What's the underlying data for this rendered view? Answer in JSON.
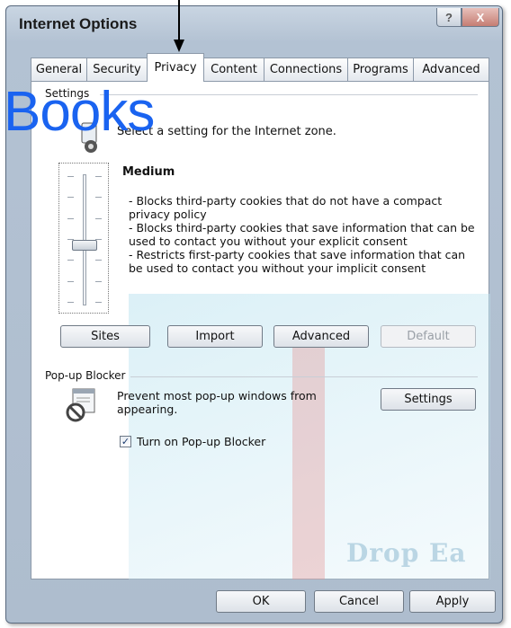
{
  "window": {
    "title": "Internet Options",
    "help_glyph": "?",
    "close_glyph": "X"
  },
  "tabs": [
    {
      "label": "General"
    },
    {
      "label": "Security"
    },
    {
      "label": "Privacy"
    },
    {
      "label": "Content"
    },
    {
      "label": "Connections"
    },
    {
      "label": "Programs"
    },
    {
      "label": "Advanced"
    }
  ],
  "active_tab": "Privacy",
  "settings": {
    "group_label": "Settings",
    "zone_text": "Select a setting for the Internet zone.",
    "level_name": "Medium",
    "description": [
      "- Blocks third-party cookies that do not have a compact privacy policy",
      "- Blocks third-party cookies that save information that can be used to contact you without your explicit consent",
      "- Restricts first-party cookies that save information that can be used to contact you without your implicit consent"
    ],
    "slider_level_fraction": 0.5,
    "buttons": {
      "sites": "Sites",
      "import": "Import",
      "advanced": "Advanced",
      "default": "Default"
    }
  },
  "popup_blocker": {
    "group_label": "Pop-up Blocker",
    "text": "Prevent most pop-up windows from appearing.",
    "settings_button": "Settings",
    "checkbox_label": "Turn on Pop-up Blocker",
    "checked": true
  },
  "footer": {
    "ok": "OK",
    "cancel": "Cancel",
    "apply": "Apply"
  },
  "overlay": {
    "books_text": "Books",
    "watermark_text": "Drop Ea"
  },
  "colors": {
    "books_blue": "#1a63f0",
    "window_frame": "#b3c2d3"
  }
}
